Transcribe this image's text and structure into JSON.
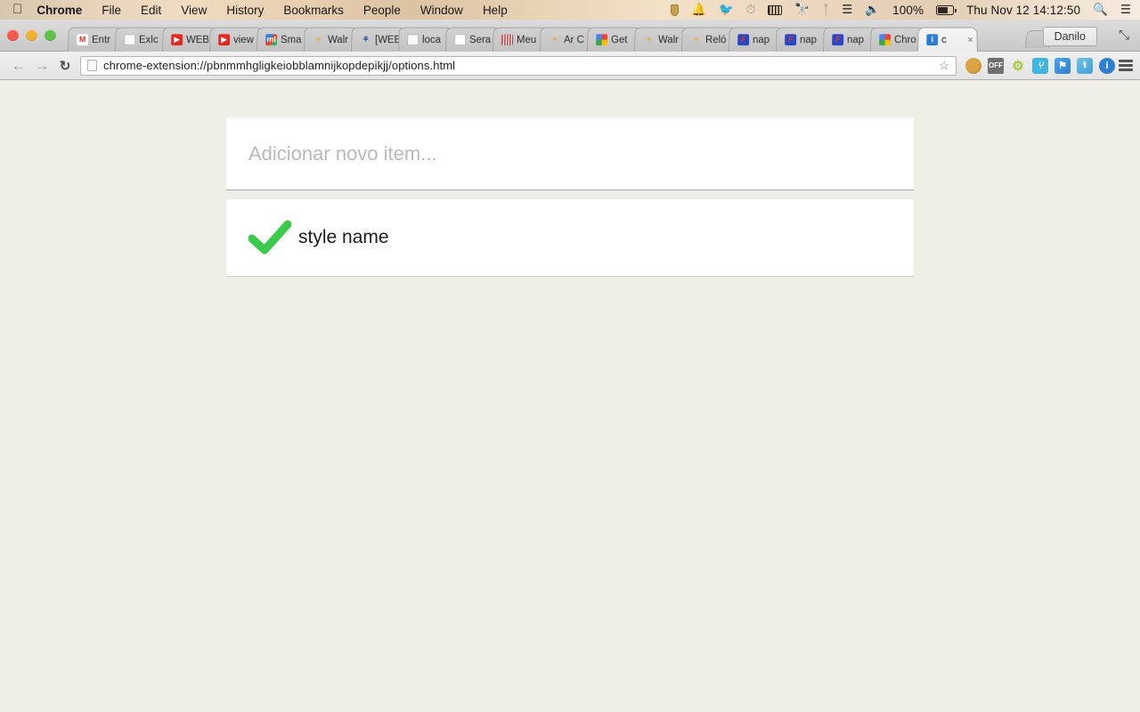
{
  "menubar": {
    "apple_icon": "apple-logo",
    "app_name": "Chrome",
    "items": [
      "File",
      "Edit",
      "View",
      "History",
      "Bookmarks",
      "People",
      "Window",
      "Help"
    ],
    "status_icons": [
      "shield-icon",
      "bell-icon",
      "evernote-icon",
      "clock-icon",
      "calendar-icon",
      "binoculars-icon",
      "bluetooth-icon",
      "wifi-icon",
      "volume-icon"
    ],
    "battery_percent": "100%",
    "battery_icon": "battery-icon",
    "clock": "Thu Nov 12  14:12:50",
    "spotlight_icon": "search-icon",
    "notification_icon": "notification-center-icon"
  },
  "browser": {
    "window_controls": [
      "close-button",
      "minimize-button",
      "zoom-button"
    ],
    "tabs": [
      {
        "label": "Entr",
        "favicon": "gmail-icon",
        "glyph": "M",
        "cls": "fv-gmail",
        "active": false
      },
      {
        "label": "Exlc",
        "favicon": "document-icon",
        "glyph": "",
        "cls": "fv-doc",
        "active": false
      },
      {
        "label": "WEB",
        "favicon": "youtube-icon",
        "glyph": "▶",
        "cls": "fv-yt",
        "active": false
      },
      {
        "label": "view",
        "favicon": "youtube-icon",
        "glyph": "▶",
        "cls": "fv-yt",
        "active": false
      },
      {
        "label": "Sma",
        "favicon": "mailchimp-icon",
        "glyph": "ml",
        "cls": "fv-ml",
        "active": false
      },
      {
        "label": "Walr",
        "favicon": "walmart-icon",
        "glyph": "✳",
        "cls": "fv-star",
        "active": false
      },
      {
        "label": "[WEB",
        "favicon": "webmotors-icon",
        "glyph": "⚘",
        "cls": "fv-x",
        "active": false
      },
      {
        "label": "loca",
        "favicon": "document-icon",
        "glyph": "",
        "cls": "fv-doc",
        "active": false
      },
      {
        "label": "Sera",
        "favicon": "page-icon",
        "glyph": "",
        "cls": "fv-sera",
        "active": false
      },
      {
        "label": "Meu",
        "favicon": "barcode-icon",
        "glyph": "",
        "cls": "fv-meu",
        "active": false
      },
      {
        "label": "Ar C",
        "favicon": "walmart-icon",
        "glyph": "✳",
        "cls": "fv-star",
        "active": false
      },
      {
        "label": "Get",
        "favicon": "google-icon",
        "glyph": "",
        "cls": "fv-g",
        "active": false
      },
      {
        "label": "Walr",
        "favicon": "walmart-icon",
        "glyph": "✳",
        "cls": "fv-star",
        "active": false
      },
      {
        "label": "Reló",
        "favicon": "walmart-icon",
        "glyph": "✳",
        "cls": "fv-star",
        "active": false
      },
      {
        "label": "nap",
        "favicon": "napster-icon",
        "glyph": "F",
        "cls": "fv-nap",
        "active": false
      },
      {
        "label": "nap",
        "favicon": "napster-icon",
        "glyph": "F",
        "cls": "fv-nap",
        "active": false
      },
      {
        "label": "nap",
        "favicon": "napster-icon",
        "glyph": "F",
        "cls": "fv-nap",
        "active": false
      },
      {
        "label": "Chro",
        "favicon": "google-icon",
        "glyph": "",
        "cls": "fv-g",
        "active": false
      },
      {
        "label": "c",
        "favicon": "info-icon",
        "glyph": "i",
        "cls": "fv-info",
        "active": true
      }
    ],
    "close_tab_glyph": "×",
    "new_tab_button": "new-tab-button",
    "profile_name": "Danilo",
    "fullscreen_icon": "⤡",
    "nav": {
      "back_glyph": "←",
      "forward_glyph": "→",
      "reload_glyph": "↻"
    },
    "url": "chrome-extension://pbnmmhgligkeiobblamnijkopdepikjj/options.html",
    "bookmark_star_glyph": "☆",
    "extensions": [
      {
        "name": "cookie-extension-icon",
        "glyph": "",
        "cls": "ext-cookie"
      },
      {
        "name": "off-toggle-extension-icon",
        "glyph": "OFF",
        "cls": "ext-off"
      },
      {
        "name": "android-extension-icon",
        "glyph": "⚙",
        "cls": "ext-android"
      },
      {
        "name": "blue-extension-icon",
        "glyph": "⑂",
        "cls": "ext-blue"
      },
      {
        "name": "tag-extension-icon",
        "glyph": "⚑",
        "cls": "ext-tag"
      },
      {
        "name": "stethoscope-extension-icon",
        "glyph": "⚕",
        "cls": "ext-steth"
      },
      {
        "name": "info-extension-icon",
        "glyph": "i",
        "cls": "ext-info"
      }
    ],
    "menu_button": "chrome-menu-button"
  },
  "page": {
    "add_item": {
      "placeholder": "Adicionar novo item...",
      "value": ""
    },
    "items": [
      {
        "label": "style name",
        "checked": true,
        "check_color": "#3ACB4A"
      }
    ]
  }
}
